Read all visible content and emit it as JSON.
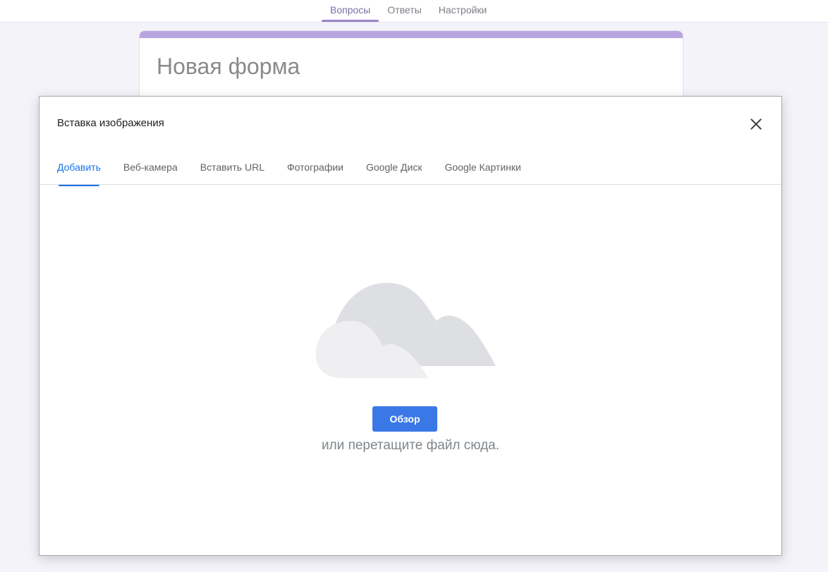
{
  "top_nav": {
    "tabs": [
      {
        "label": "Вопросы",
        "active": true
      },
      {
        "label": "Ответы",
        "active": false
      },
      {
        "label": "Настройки",
        "active": false
      }
    ]
  },
  "form": {
    "title": "Новая форма",
    "accent_color": "#b9a5e0"
  },
  "dialog": {
    "title": "Вставка изображения",
    "close_icon": "close-icon",
    "tabs": [
      {
        "label": "Добавить",
        "active": true
      },
      {
        "label": "Веб-камера",
        "active": false
      },
      {
        "label": "Вставить URL",
        "active": false
      },
      {
        "label": "Фотографии",
        "active": false
      },
      {
        "label": "Google Диск",
        "active": false
      },
      {
        "label": "Google Картинки",
        "active": false
      }
    ],
    "upload": {
      "illustration_icon": "cloud-icon",
      "browse_label": "Обзор",
      "drop_hint": "или перетащите файл сюда.",
      "button_color": "#3b78e7"
    }
  }
}
